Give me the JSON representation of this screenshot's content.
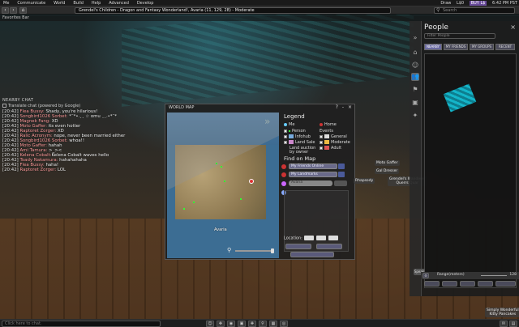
{
  "menu": {
    "items": [
      "Me",
      "Communicate",
      "World",
      "Build",
      "Help",
      "Advanced",
      "Develop"
    ]
  },
  "status": {
    "draw": "Draw",
    "balance": "L$0",
    "buy": "BUY L$",
    "time": "6:42 PM PST"
  },
  "nav": {
    "location": "Grendel's Children - Dragon and Fantasy Wonderland!, Avaria (11, 129, 28) - Moderate",
    "search_placeholder": "Search"
  },
  "favorites": {
    "label": "Favorites Bar"
  },
  "chat": {
    "title": "NEARBY CHAT",
    "translate": "Translate chat (powered by Google)",
    "lines": [
      {
        "time": "[20:42]",
        "user": "Flea Bussy:",
        "msg": " Shady, you're hilarious!"
      },
      {
        "time": "[20:42]",
        "user": "Songbird1026 Sorbet:",
        "msg": " *¨*•.¸¸ ☆ omu ¸¸.•*¨*"
      },
      {
        "time": "[20:42]",
        "user": "Magnek Fang:",
        "msg": " XD"
      },
      {
        "time": "[20:42]",
        "user": "Moto Gaffer:",
        "msg": " its even hotter"
      },
      {
        "time": "[20:42]",
        "user": "Raptoret Zorger:",
        "msg": " XD"
      },
      {
        "time": "[20:42]",
        "user": "Ralic Acronym:",
        "msg": " nope, never been married either"
      },
      {
        "time": "[20:42]",
        "user": "Songbird1026 Sorbet:",
        "msg": " whoa!!"
      },
      {
        "time": "[20:42]",
        "user": "Moto Gaffer:",
        "msg": " hahah"
      },
      {
        "time": "[20:42]",
        "user": "Ami Tamura:",
        "msg": " >_><"
      },
      {
        "time": "[20:42]",
        "user": "Kelena Cobalt:",
        "msg": "Kelena Cobalt waves hello"
      },
      {
        "time": "[20:42]",
        "user": "Toady Nakamura:",
        "msg": " hahahahaha"
      },
      {
        "time": "[20:42]",
        "user": "Flea Bussy:",
        "msg": " haha!"
      },
      {
        "time": "[20:42]",
        "user": "Raptoret Zorger:",
        "msg": " LOL"
      }
    ]
  },
  "worldmap": {
    "title": "WORLD MAP",
    "controls": [
      "?",
      "-",
      "×"
    ],
    "region": "Avaria",
    "legend": {
      "title": "Legend",
      "me": "Me",
      "home": "Home",
      "person": "Person",
      "infohub": "Infohub",
      "land_sale": "Land Sale",
      "land_auction": "Land auction",
      "by_owner": "by owner",
      "events": "Events",
      "general": "General",
      "moderate": "Moderate",
      "adult": "Adult"
    },
    "find": {
      "title": "Find on Map",
      "friends": "My Friends Online",
      "landmarks": "My Landmarks",
      "search_value": "Avaria"
    },
    "location_label": "Location:",
    "colors": {
      "marker": "#dd3333",
      "legend_me": "#66ccff"
    }
  },
  "people": {
    "title": "People",
    "close": "×",
    "filter_placeholder": "Filter People",
    "tabs": [
      "NEARBY",
      "MY FRIENDS",
      "MY GROUPS",
      "RECENT"
    ],
    "range_label": "Range(meters)",
    "range_value": "128"
  },
  "nametags": [
    {
      "text": "Moto Gaffer"
    },
    {
      "text": "Gal Dresser"
    },
    {
      "text": "Grendel's Wanderer\nQuerrs Quar"
    },
    {
      "text": "Simply Wonderful\nKitty Pancakes"
    },
    {
      "text": "Rhapsody"
    }
  ],
  "bottom": {
    "chat_placeholder": "Click here to chat.",
    "speak": "Speak"
  }
}
